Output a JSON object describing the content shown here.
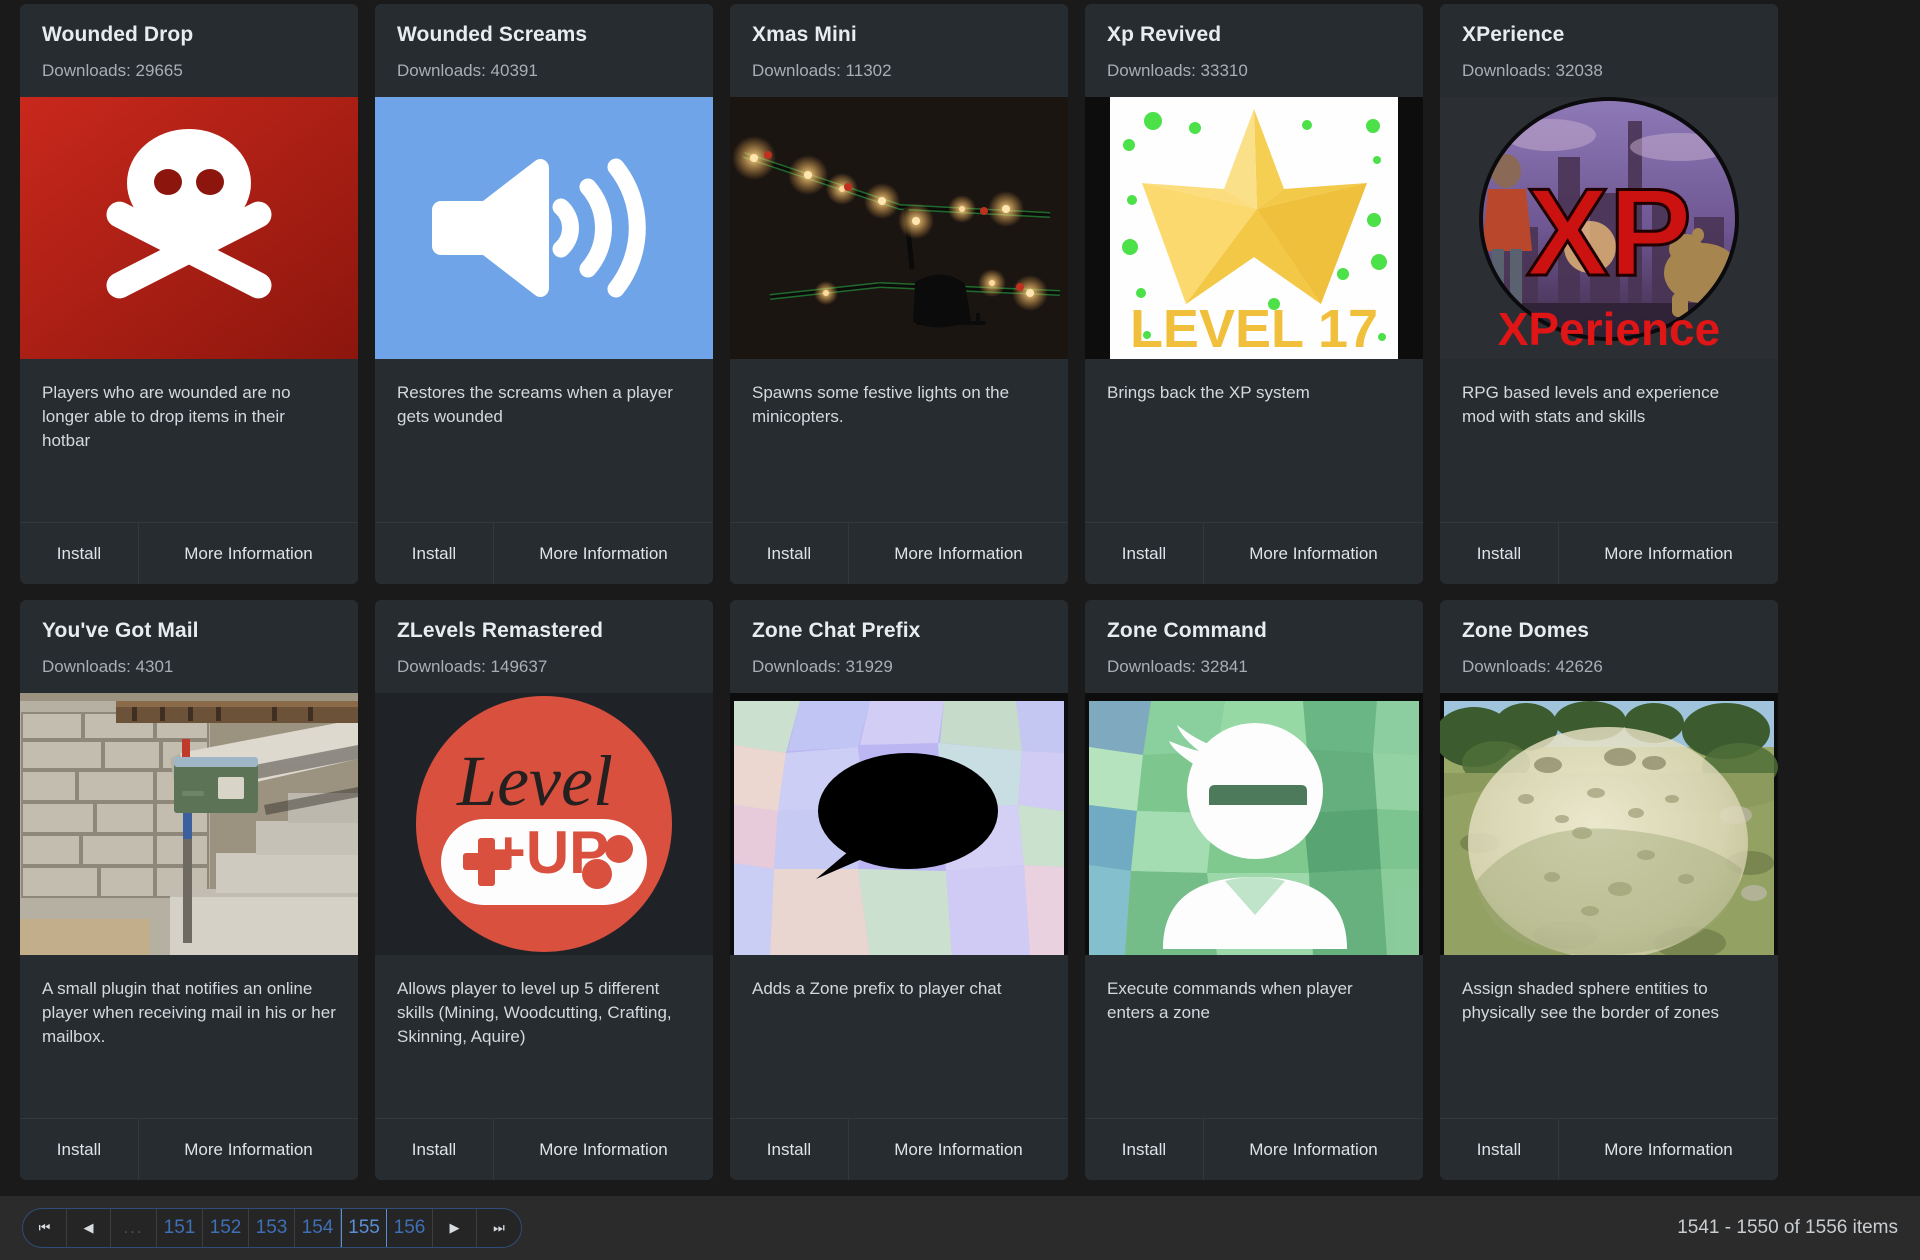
{
  "theme": {
    "page_bg": "#1a1a1a",
    "card_bg": "#272c31",
    "accent_blue": "#3f6fb5",
    "active_blue": "#5a8fd6",
    "text_primary": "#e9ecef",
    "text_muted": "#a7aeb5"
  },
  "buttons": {
    "install": "Install",
    "more_information": "More Information"
  },
  "cards": [
    {
      "title": "Wounded Drop",
      "downloads": "Downloads: 29665",
      "description": "Players who are wounded are no longer able to drop items in their hotbar",
      "media": {
        "icon": "skull-crossbones-icon",
        "bg": "#b51f14"
      }
    },
    {
      "title": "Wounded Screams",
      "downloads": "Downloads: 40391",
      "description": "Restores the screams when a player gets wounded",
      "media": {
        "icon": "speaker-volume-icon",
        "bg": "#6fa5e8"
      }
    },
    {
      "title": "Xmas Mini",
      "downloads": "Downloads: 11302",
      "description": "Spawns some festive lights on the minicopters.",
      "media": {
        "icon": "minicopter-christmas-lights-photo",
        "bg": "#19120f"
      }
    },
    {
      "title": "Xp Revived",
      "downloads": "Downloads: 33310",
      "description": "Brings back the XP system",
      "media": {
        "icon": "gold-star-level-icon",
        "bg": "#ffffff",
        "label": "LEVEL 17"
      }
    },
    {
      "title": "XPerience",
      "downloads": "Downloads: 32038",
      "description": "RPG based levels and experience mod with stats and skills",
      "media": {
        "icon": "xperience-logo",
        "bg": "#2b2f33",
        "label": "XP",
        "sublabel": "XPerience"
      }
    },
    {
      "title": "You've Got Mail",
      "downloads": "Downloads: 4301",
      "description": "A small plugin that notifies an online player when receiving mail in his or her mailbox.",
      "media": {
        "icon": "mailbox-stairs-photo",
        "bg": "#b6ada0"
      }
    },
    {
      "title": "ZLevels Remastered",
      "downloads": "Downloads: 149637",
      "description": "Allows player to level up 5 different skills (Mining, Woodcutting, Crafting, Skinning, Aquire)",
      "media": {
        "icon": "level-up-gamepad-icon",
        "bg": "#1f2328",
        "label": "Level",
        "sublabel": "+UP"
      }
    },
    {
      "title": "Zone Chat Prefix",
      "downloads": "Downloads: 31929",
      "description": "Adds a Zone prefix to player chat",
      "media": {
        "icon": "speech-bubble-icon",
        "bg": "#bdb8ef"
      }
    },
    {
      "title": "Zone Command",
      "downloads": "Downloads: 32841",
      "description": "Execute commands when player enters a zone",
      "media": {
        "icon": "ninja-avatar-icon",
        "bg": "#7fcf97"
      }
    },
    {
      "title": "Zone Domes",
      "downloads": "Downloads: 42626",
      "description": "Assign shaded sphere entities to physically see the border of zones",
      "media": {
        "icon": "zone-dome-photo",
        "bg": "#8a9a5c"
      }
    }
  ],
  "pagination": {
    "first_label": "⏮",
    "prev_label": "◀",
    "ellipsis_label": "...",
    "pages": [
      "151",
      "152",
      "153",
      "154",
      "155",
      "156"
    ],
    "active_page": "155",
    "next_label": "▶",
    "last_label": "⏭"
  },
  "status": {
    "items_range": "1541 - 1550 of 1556 items"
  }
}
